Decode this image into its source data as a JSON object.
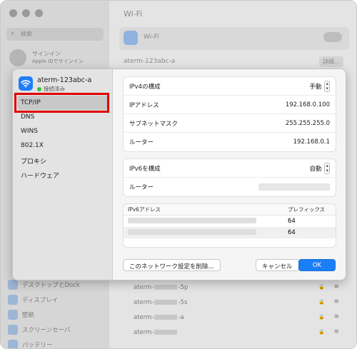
{
  "background": {
    "title": "Wi-Fi",
    "search_placeholder": "検索",
    "user": {
      "name": "サインイン",
      "sub": "Apple IDでサインイン"
    },
    "wifi_label": "Wi-Fi",
    "connected_network": "aterm-123abc-a",
    "details_label": "詳細...",
    "sidebar_items": [
      {
        "label": "デスクトップとDock",
        "icon": "desktop-icon"
      },
      {
        "label": "ディスプレイ",
        "icon": "display-icon"
      },
      {
        "label": "壁紙",
        "icon": "wallpaper-icon"
      },
      {
        "label": "スクリーンセーバ",
        "icon": "screensaver-icon"
      },
      {
        "label": "バッテリー",
        "icon": "battery-icon"
      }
    ],
    "networks": [
      {
        "prefix": "aterm-",
        "suffix": "-5p"
      },
      {
        "prefix": "aterm-",
        "suffix": "-5s"
      },
      {
        "prefix": "aterm-",
        "suffix": "-a"
      },
      {
        "prefix": "aterm-",
        "suffix": ""
      }
    ]
  },
  "dialog": {
    "network_name": "aterm-123abc-a",
    "status": "接続済み",
    "nav": [
      {
        "label": "TCP/IP",
        "active": true
      },
      {
        "label": "DNS"
      },
      {
        "label": "WINS"
      },
      {
        "label": "802.1X"
      },
      {
        "label": "プロキシ"
      },
      {
        "label": "ハードウェア"
      }
    ],
    "ipv4": {
      "configure_label": "IPv4の構成",
      "configure_value": "手動",
      "ip_label": "IPアドレス",
      "ip_value": "192.168.0.100",
      "subnet_label": "サブネットマスク",
      "subnet_value": "255.255.255.0",
      "router_label": "ルーター",
      "router_value": "192.168.0.1"
    },
    "ipv6": {
      "configure_label": "IPv6を構成",
      "configure_value": "自動",
      "router_label": "ルーター"
    },
    "ipv6_table": {
      "col_address": "IPv6アドレス",
      "col_prefix": "プレフィックス",
      "rows": [
        {
          "prefix": "64"
        },
        {
          "prefix": "64"
        }
      ]
    },
    "buttons": {
      "delete": "このネットワーク設定を削除...",
      "cancel": "キャンセル",
      "ok": "OK"
    }
  },
  "colors": {
    "accent": "#1a7ef5",
    "highlight": "#e00000",
    "connected": "#33c23e"
  }
}
